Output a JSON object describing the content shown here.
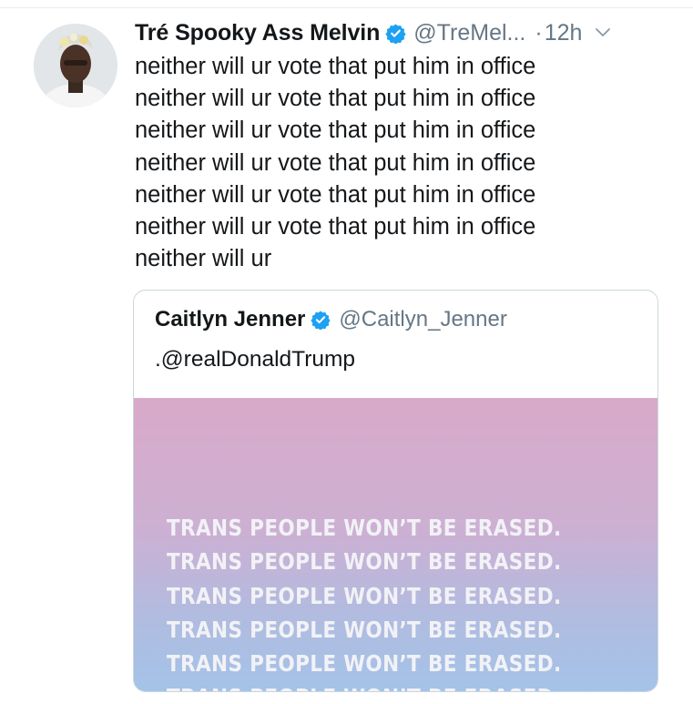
{
  "tweet": {
    "author_name": "Tré Spooky Ass Melvin",
    "handle": "@TreMel...",
    "time_separator": "·",
    "timestamp": "12h",
    "verified": true,
    "text": "neither will ur vote that put him in office\nneither will ur vote that put him in office\nneither will ur vote that put him in office\nneither will ur vote that put him in office\nneither will ur vote that put him in office\nneither will ur vote that put him in office\nneither will ur"
  },
  "quoted_tweet": {
    "author_name": "Caitlyn Jenner",
    "handle": "@Caitlyn_Jenner",
    "verified": true,
    "text": ".@realDonaldTrump",
    "image_lines": [
      "TRANS PEOPLE WON’T BE ERASED.",
      "TRANS PEOPLE WON’T BE ERASED.",
      "TRANS PEOPLE WON’T BE ERASED.",
      "TRANS PEOPLE WON’T BE ERASED.",
      "TRANS PEOPLE WON’T BE ERASED.",
      "TRANS PEOPLE WON’T BE ERASED."
    ]
  },
  "icons": {
    "verified_badge": "verified-badge-icon",
    "menu": "chevron-down-icon"
  },
  "colors": {
    "verified_blue": "#1da1f2",
    "secondary_text": "#657786",
    "image_gradient_top": "#d9a9c9",
    "image_gradient_bottom": "#a4c3e8"
  }
}
